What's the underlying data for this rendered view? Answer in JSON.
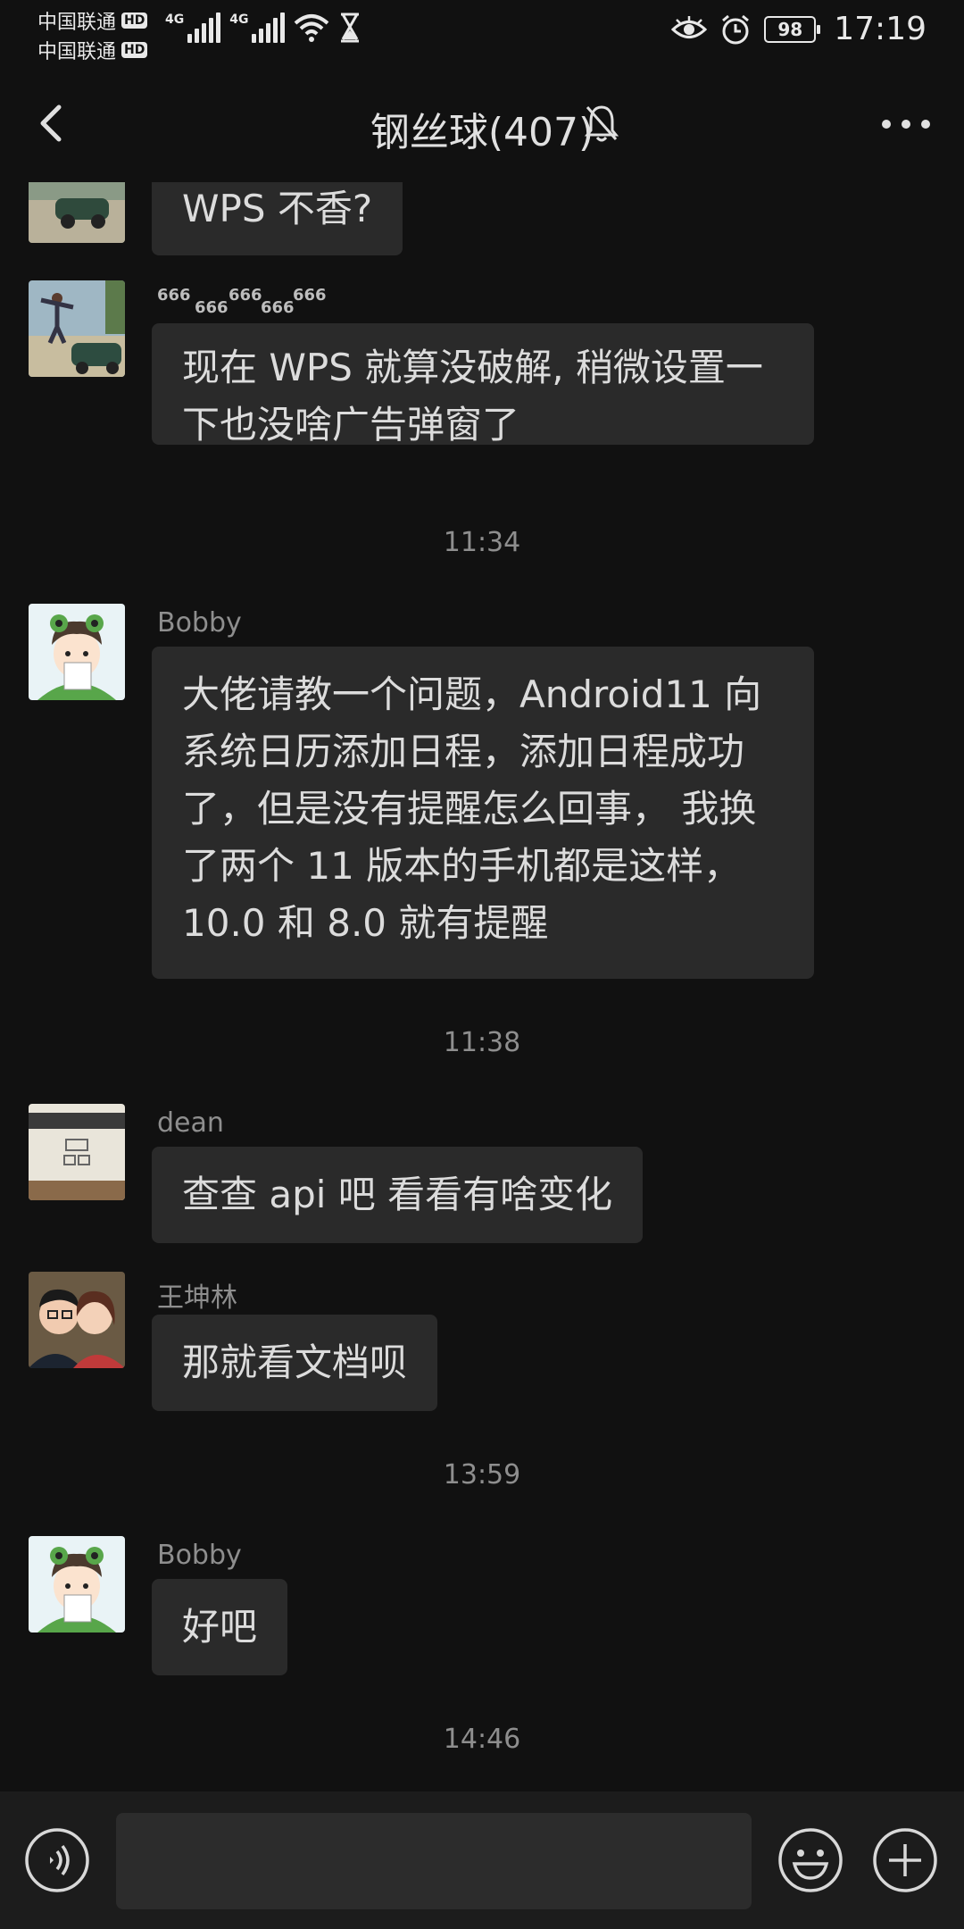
{
  "status": {
    "carrier1": "中国联通",
    "carrier2": "中国联通",
    "hd": "HD",
    "net1": "4G",
    "net2": "4G",
    "battery": "98",
    "time": "17:19"
  },
  "header": {
    "title": "钢丝球(407)"
  },
  "messages": {
    "m0_text": "WPS 不香?",
    "m1_flying": [
      "666",
      "666",
      "666",
      "666",
      "666"
    ],
    "m1_text_line1": "现在 WPS 就算没破解, 稍微设置一",
    "m1_text_line2": "下也没啥广告弹窗了",
    "t1": "11:34",
    "m2_sender": "Bobby",
    "m2_line1": "大佬请教一个问题，Android11 向",
    "m2_line2": "系统日历添加日程，添加日程成功",
    "m2_line3": "了，但是没有提醒怎么回事， 我换",
    "m2_line4": "了两个 11 版本的手机都是这样，",
    "m2_line5": "10.0 和 8.0 就有提醒",
    "t2": "11:38",
    "m3_sender": "dean",
    "m3_text": "查查 api 吧 看看有啥变化",
    "m4_sender": "王坤林",
    "m4_text": "那就看文档呗",
    "t3": "13:59",
    "m5_sender": "Bobby",
    "m5_text": "好吧",
    "t4": "14:46"
  },
  "input": {
    "value": "",
    "placeholder": ""
  },
  "colors": {
    "background": "#111111",
    "bubble": "#2a2a2a",
    "input_bar": "#1c1c1c",
    "meta_text": "#8e8e8e"
  },
  "icons": {
    "back": "chevron-left-icon",
    "mute": "bell-off-icon",
    "more": "more-dots-icon",
    "voice": "voice-icon",
    "emoji": "emoji-icon",
    "plus": "plus-icon"
  }
}
